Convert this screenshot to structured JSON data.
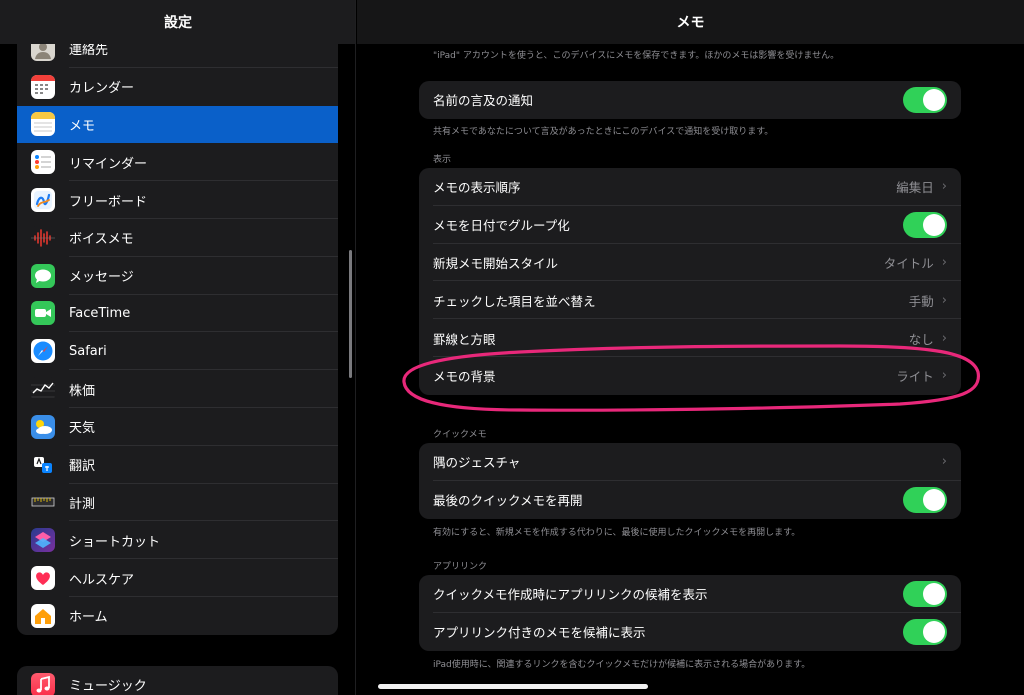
{
  "sidebar": {
    "title": "設定",
    "items": [
      {
        "label": "連絡先",
        "icon": "contacts-icon"
      },
      {
        "label": "カレンダー",
        "icon": "calendar-icon"
      },
      {
        "label": "メモ",
        "icon": "notes-icon",
        "selected": true
      },
      {
        "label": "リマインダー",
        "icon": "reminders-icon"
      },
      {
        "label": "フリーボード",
        "icon": "freeform-icon"
      },
      {
        "label": "ボイスメモ",
        "icon": "voice-memos-icon"
      },
      {
        "label": "メッセージ",
        "icon": "messages-icon"
      },
      {
        "label": "FaceTime",
        "icon": "facetime-icon"
      },
      {
        "label": "Safari",
        "icon": "safari-icon"
      },
      {
        "label": "株価",
        "icon": "stocks-icon"
      },
      {
        "label": "天気",
        "icon": "weather-icon"
      },
      {
        "label": "翻訳",
        "icon": "translate-icon"
      },
      {
        "label": "計測",
        "icon": "measure-icon"
      },
      {
        "label": "ショートカット",
        "icon": "shortcuts-icon"
      },
      {
        "label": "ヘルスケア",
        "icon": "health-icon"
      },
      {
        "label": "ホーム",
        "icon": "home-icon"
      }
    ],
    "items2": [
      {
        "label": "ミュージック",
        "icon": "music-icon"
      }
    ]
  },
  "main": {
    "title": "メモ",
    "top_note": "\"iPad\" アカウントを使うと、このデバイスにメモを保存できます。ほかのメモは影響を受けません。",
    "mention_card": {
      "label": "名前の言及の通知",
      "toggle_on": true,
      "footer": "共有メモであなたについて言及があったときにこのデバイスで通知を受け取ります。"
    },
    "display_section": {
      "title": "表示",
      "rows": [
        {
          "label": "メモの表示順序",
          "value": "編集日",
          "type": "nav"
        },
        {
          "label": "メモを日付でグループ化",
          "type": "toggle",
          "on": true
        },
        {
          "label": "新規メモ開始スタイル",
          "value": "タイトル",
          "type": "nav"
        },
        {
          "label": "チェックした項目を並べ替え",
          "value": "手動",
          "type": "nav"
        },
        {
          "label": "罫線と方眼",
          "value": "なし",
          "type": "nav"
        },
        {
          "label": "メモの背景",
          "value": "ライト",
          "type": "nav"
        }
      ]
    },
    "quick_section": {
      "title": "クイックメモ",
      "rows": [
        {
          "label": "隅のジェスチャ",
          "value": "",
          "type": "nav"
        },
        {
          "label": "最後のクイックメモを再開",
          "type": "toggle",
          "on": true
        }
      ],
      "footer": "有効にすると、新規メモを作成する代わりに、最後に使用したクイックメモを再開します。"
    },
    "applink_section": {
      "title": "アプリリンク",
      "rows": [
        {
          "label": "クイックメモ作成時にアプリリンクの候補を表示",
          "type": "toggle",
          "on": true
        },
        {
          "label": "アプリリンク付きのメモを候補に表示",
          "type": "toggle",
          "on": true
        }
      ],
      "footer": "iPad使用時に、関連するリンクを含むクイックメモだけが候補に表示される場合があります。"
    }
  },
  "colors": {
    "accent_selected": "#0a60c9",
    "toggle_on": "#30d158",
    "annotation": "#e8287a"
  }
}
